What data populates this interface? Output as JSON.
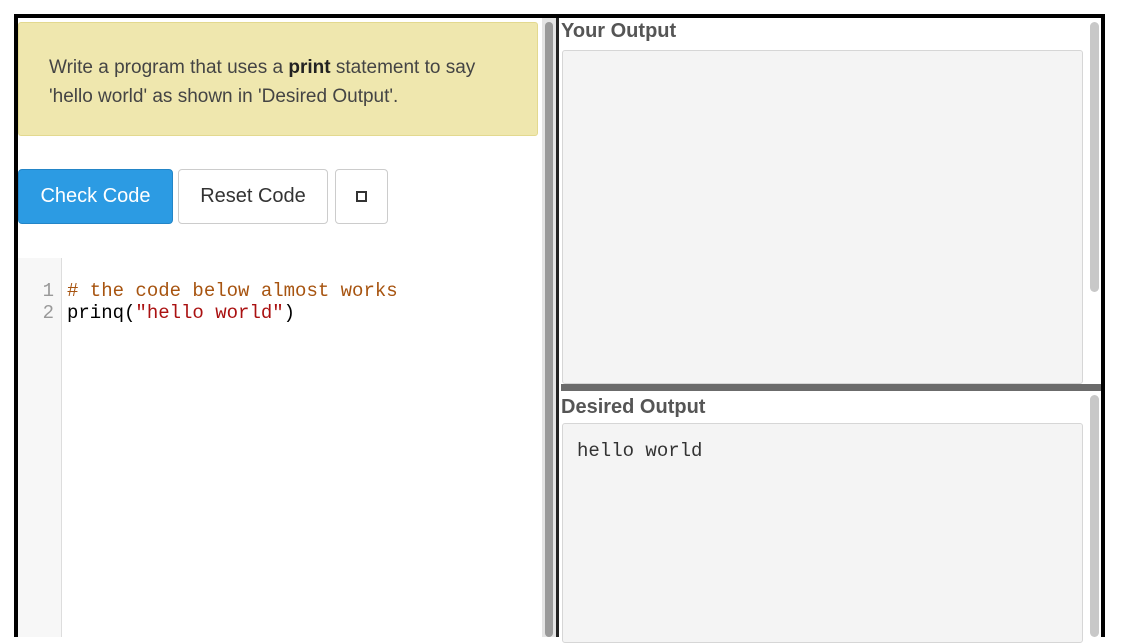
{
  "instructions": {
    "before": "Write a program that uses a ",
    "bold": "print",
    "after": " statement to say 'hello world' as shown in 'Desired Output'."
  },
  "toolbar": {
    "check_label": "Check Code",
    "reset_label": "Reset Code",
    "icon": "square-icon"
  },
  "editor": {
    "lines": [
      {
        "number": "1",
        "text": "# the code below almost works",
        "kind": "comment"
      },
      {
        "number": "2",
        "before": "prinq(",
        "string": "\"hello world\"",
        "after": ")"
      }
    ]
  },
  "your_output": {
    "title": "Your Output",
    "text": ""
  },
  "desired_output": {
    "title": "Desired Output",
    "text": "hello world"
  },
  "colors": {
    "primary": "#2c9be3",
    "instructions_bg": "#efe7ae",
    "comment": "#a75410",
    "string": "#a11111"
  }
}
